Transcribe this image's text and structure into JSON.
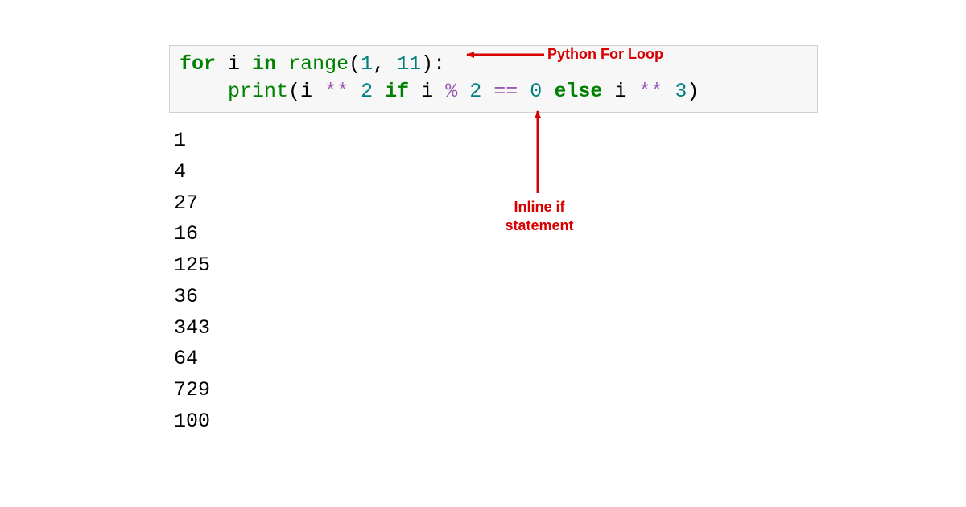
{
  "code": {
    "line1": {
      "for_kw": "for",
      "var_i": "i",
      "in_kw": "in",
      "range_fn": "range",
      "args": "(1, 11):",
      "num_1": "1",
      "num_11": "11"
    },
    "line2": {
      "indent": "    ",
      "print_fn": "print",
      "open": "(",
      "var_i": "i",
      "star": "**",
      "num_2": "2",
      "if_kw": "if",
      "var_i_b": "i",
      "pct": "%",
      "num_2b": "2",
      "eq": "==",
      "num_0": "0",
      "else_kw": "else",
      "var_i_c": "i",
      "star_b": "**",
      "num_3": "3",
      "close": ")"
    }
  },
  "output_lines": [
    "1",
    "4",
    "27",
    "16",
    "125",
    "36",
    "343",
    "64",
    "729",
    "100"
  ],
  "annotations": {
    "for_loop": "Python For Loop",
    "inline_if": "Inline if statement"
  },
  "colors": {
    "annotation": "#d80000",
    "keyword": "#008000",
    "operator": "#9b59b6",
    "number": "#008080",
    "code_bg": "#f7f7f7",
    "code_border": "#d0d0d0"
  }
}
